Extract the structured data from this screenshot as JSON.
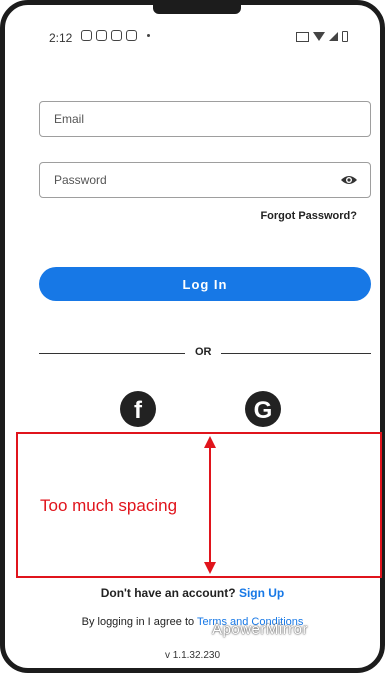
{
  "status_bar": {
    "time": "2:12"
  },
  "form": {
    "email_placeholder": "Email",
    "password_placeholder": "Password",
    "forgot_password": "Forgot Password?",
    "login_label": "Log In",
    "divider_text": "OR"
  },
  "social": {
    "facebook_glyph": "f",
    "google_glyph": "G"
  },
  "annotation": {
    "text": "Too much spacing",
    "color": "#e0141c"
  },
  "footer": {
    "no_account": "Don't have an account?",
    "sign_up": "Sign Up",
    "terms_prefix": "By logging in I agree to",
    "terms_link": "Terms and Conditions",
    "watermark": "ApowerMirror",
    "version": "v 1.1.32.230"
  },
  "colors": {
    "accent": "#1778e6",
    "annotation": "#e0141c"
  }
}
